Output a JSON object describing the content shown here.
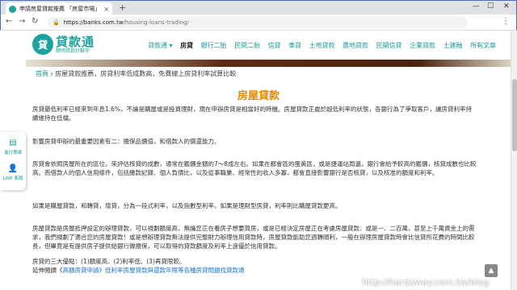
{
  "browser": {
    "tab_title": "申請房屋貸款推薦 「房屋市場」",
    "tab_close": "×",
    "new_tab": "+",
    "url_host": "https://banks.com.tw",
    "url_path": "/housing-loans-trading/",
    "minimize": "—",
    "maximize": "☐",
    "close": "✕",
    "back": "←",
    "forward": "→",
    "reload": "↻",
    "menu": "⋮"
  },
  "site": {
    "logo_mark": "貸",
    "logo_name": "貸款通",
    "logo_sub": "聰明貸款好夥伴",
    "nav": [
      "貸款通 ▾",
      "房貸",
      "銀行二胎",
      "民間二胎",
      "信貸",
      "車貸",
      "土地貸款",
      "農地貸款",
      "民間信貸",
      "企業貸款",
      "土建融",
      "所有文章"
    ],
    "nav_active_index": 1
  },
  "breadcrumb": {
    "home": "首頁",
    "sep": "›",
    "current": "房屋貸款推薦，房貸利率低成數高，免費線上房貸利率試算比較"
  },
  "content": {
    "title": "房屋貸款",
    "p1": "房貸最低利率已經來到年息1.6%，不論是購屋或是投資理財，現在申辦房貸是相當好的時機。房屋貸款正處於超低利率的狀態，各銀行為了爭取客戶，讓房貸利率持續維持在低檔。",
    "p2": "影響房貸申辦的最重要因素有二：擔保品價值，和借款人的償還能力。",
    "p3": "房貸會依照房屋所在的區位，來評估核貸的成數，通常在鑑價金額的7～8成左右。如果在都會區的蛋黃區，或是捷運站周邊，銀行會給予較高的鑑價，核貸成數也比較高。而借款人的個人信用條件，包括繳款記錄、個人負債比，以及從事職業、經常性的收入多寡，都會直接影響銀行是否核貸，以及核准的額度和利率。",
    "p4": "如果是購屋貸款，和轉貸，增貸，分為一段式利率，以及指數型利率。如果是理財型房貸，利率則比購屋貸款更高。",
    "p5": "房屋貸款是房屋抵押設定的辦理貸款，可以視劃額度高，無論您正在看房子想要買房，或是已經決定房屋正在考慮房屋貸款、或是一、二百萬，甚至上千萬資金上的需求，我們規劃了適合您的房屋貸款！或是想辦理貸款無法提供完整財力辦理信用貸款時，房屋貸款能助您週轉順利，一般在辦理房屋貸款時會比信貸所花費的時間比較長，但畢竟是有提供房子提供給銀行做擔保，可以取得的貸款額度及利率上遠優於信用貸款。",
    "p6": "房貸的三大優點：(1)額度高、(2)利率低、(3)再貸限較。",
    "p7_prefix": "延伸閱讀《",
    "p7_link": "高額房貸申請》低利率房屋貸款與還款年限等各種房貸問題找貸款通",
    "p7_suffix": ""
  },
  "side_widget": {
    "item1_icon": "▤",
    "item1_label": "進行專線",
    "item2_icon": "👤",
    "item2_label": "LINE 客服"
  },
  "back_top": "▲",
  "watermark": "http://hardaway.com.tw/blog"
}
